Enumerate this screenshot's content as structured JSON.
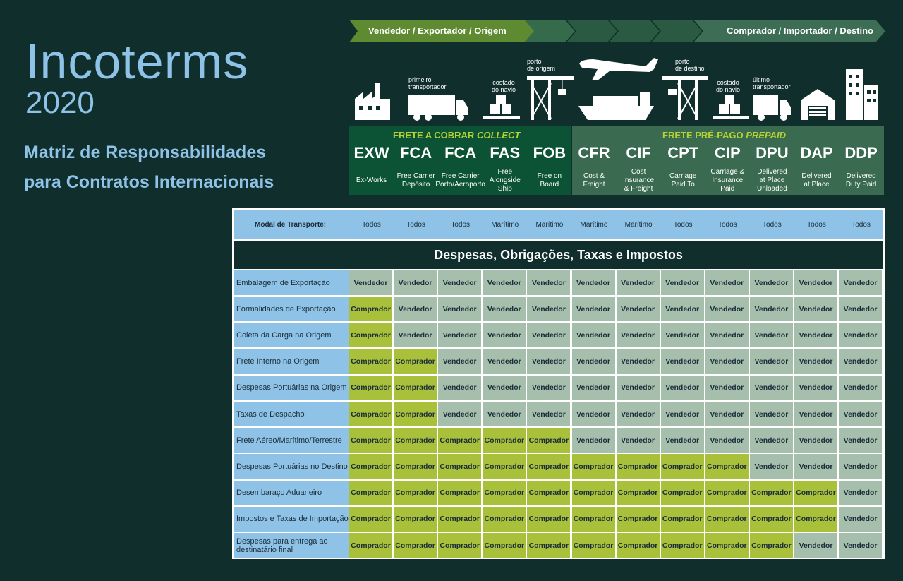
{
  "title": "Incoterms",
  "year": "2020",
  "subtitle_line1": "Matriz de Responsabilidades",
  "subtitle_line2": "para Contratos Internacionais",
  "arrow": {
    "left_label": "Vendedor / Exportador / Origem",
    "right_label": "Comprador / Importador / Destino"
  },
  "icons": {
    "truck1_caption": [
      "primeiro",
      "transportador"
    ],
    "ship_side1_caption": [
      "costado",
      "do navio"
    ],
    "port1_caption": [
      "porto",
      "de origem"
    ],
    "port2_caption": [
      "porto",
      "de destino"
    ],
    "ship_side2_caption": [
      "costado",
      "do navio"
    ],
    "truck2_caption": [
      "último",
      "transportador"
    ]
  },
  "freight": {
    "collect_prefix": "FRETE A COBRAR ",
    "collect_suffix": "COLLECT",
    "prepaid_prefix": "FRETE PRÉ-PAGO ",
    "prepaid_suffix": "PREPAID"
  },
  "terms": [
    {
      "code": "EXW",
      "desc": [
        "Ex-Works"
      ]
    },
    {
      "code": "FCA",
      "desc": [
        "Free Carrier",
        "Depósito"
      ]
    },
    {
      "code": "FCA",
      "desc": [
        "Free Carrier",
        "Porto/Aeroporto"
      ]
    },
    {
      "code": "FAS",
      "desc": [
        "Free",
        "Alongside",
        "Ship"
      ]
    },
    {
      "code": "FOB",
      "desc": [
        "Free on",
        "Board"
      ]
    },
    {
      "code": "CFR",
      "desc": [
        "Cost &",
        "Freight"
      ]
    },
    {
      "code": "CIF",
      "desc": [
        "Cost",
        "Insurance",
        "& Freight"
      ]
    },
    {
      "code": "CPT",
      "desc": [
        "Carriage",
        "Paid To"
      ]
    },
    {
      "code": "CIP",
      "desc": [
        "Carriage &",
        "Insurance",
        "Paid"
      ]
    },
    {
      "code": "DPU",
      "desc": [
        "Delivered",
        "at Place",
        "Unloaded"
      ]
    },
    {
      "code": "DAP",
      "desc": [
        "Delivered",
        "at Place"
      ]
    },
    {
      "code": "DDP",
      "desc": [
        "Delivered",
        "Duty Paid"
      ]
    }
  ],
  "modal": {
    "label": "Modal de Transporte:",
    "values": [
      "Todos",
      "Todos",
      "Todos",
      "Marítimo",
      "Marítimo",
      "Marítimo",
      "Marítimo",
      "Todos",
      "Todos",
      "Todos",
      "Todos",
      "Todos"
    ]
  },
  "section_title": "Despesas, Obrigações, Taxas e Impostos",
  "party_labels": {
    "v": "Vendedor",
    "c": "Comprador"
  },
  "rows": [
    {
      "label": "Embalagem de Exportação",
      "cells": "vvvvvvvvvvvv"
    },
    {
      "label": "Formalidades de Exportação",
      "cells": "cvvvvvvvvvvv"
    },
    {
      "label": "Coleta da Carga na Origem",
      "cells": "cvvvvvvvvvvv"
    },
    {
      "label": "Frete Interno na Origem",
      "cells": "ccvvvvvvvvvv"
    },
    {
      "label": "Despesas Portuárias na Origem",
      "cells": "ccvvvvvvvvvv"
    },
    {
      "label": "Taxas de Despacho",
      "cells": "ccvvvvvvvvvv"
    },
    {
      "label": "Frete Aéreo/Marítimo/Terrestre",
      "cells": "cccccvvvvvvv"
    },
    {
      "label": "Despesas Portuárias no Destino",
      "cells": "cccccccccvvv"
    },
    {
      "label": "Desembaraço Aduaneiro",
      "cells": "cccccccccccv"
    },
    {
      "label": "Impostos e Taxas de Importação",
      "cells": "cccccccccccv"
    },
    {
      "label": "Despesas para entrega ao destinatário final",
      "cells": "ccccccccccvv"
    }
  ],
  "colors": {
    "background": "#0f2e2c",
    "light_blue": "#8ec2e6",
    "seller": "#a6bfac",
    "buyer": "#a9c03a",
    "collect": "#0c5234",
    "prepaid": "#3a6a4f",
    "accent": "#b5d334"
  }
}
